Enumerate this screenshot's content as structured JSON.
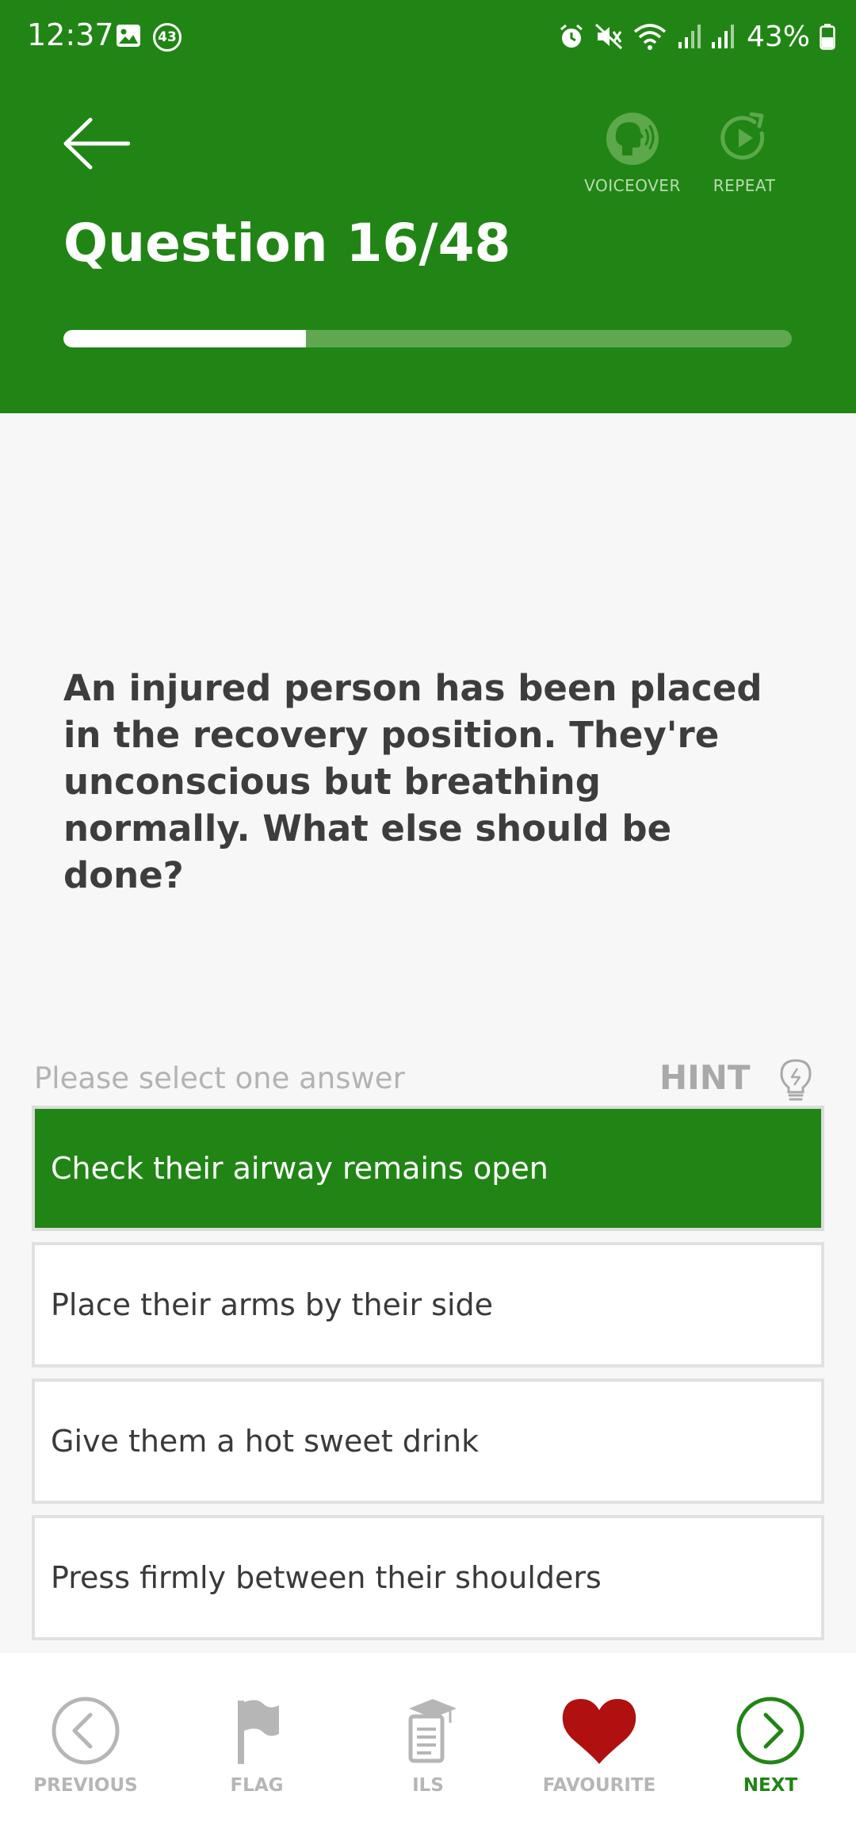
{
  "status_bar": {
    "time": "12:37",
    "notification_count": "43",
    "battery": "43%"
  },
  "header": {
    "title": "Question 16/48",
    "voiceover_label": "VOICEOVER",
    "repeat_label": "REPEAT",
    "progress": {
      "current": 16,
      "total": 48
    }
  },
  "question": {
    "text": "An injured person has been placed in the recovery position. They're unconscious but breathing normally. What else should be done?"
  },
  "answers": {
    "prompt": "Please select one answer",
    "hint_label": "HINT",
    "options": [
      {
        "label": "Check their airway remains open",
        "selected": true
      },
      {
        "label": "Place their arms by their side",
        "selected": false
      },
      {
        "label": "Give them a hot sweet drink",
        "selected": false
      },
      {
        "label": "Press firmly between their shoulders",
        "selected": false
      }
    ]
  },
  "bottom_nav": {
    "previous": "PREVIOUS",
    "flag": "FLAG",
    "ils": "ILS",
    "favourite": "FAVOURITE",
    "next": "NEXT"
  },
  "colors": {
    "brand_green": "#218515",
    "favourite_red": "#b01010",
    "muted_gray": "#b6b6b6"
  }
}
